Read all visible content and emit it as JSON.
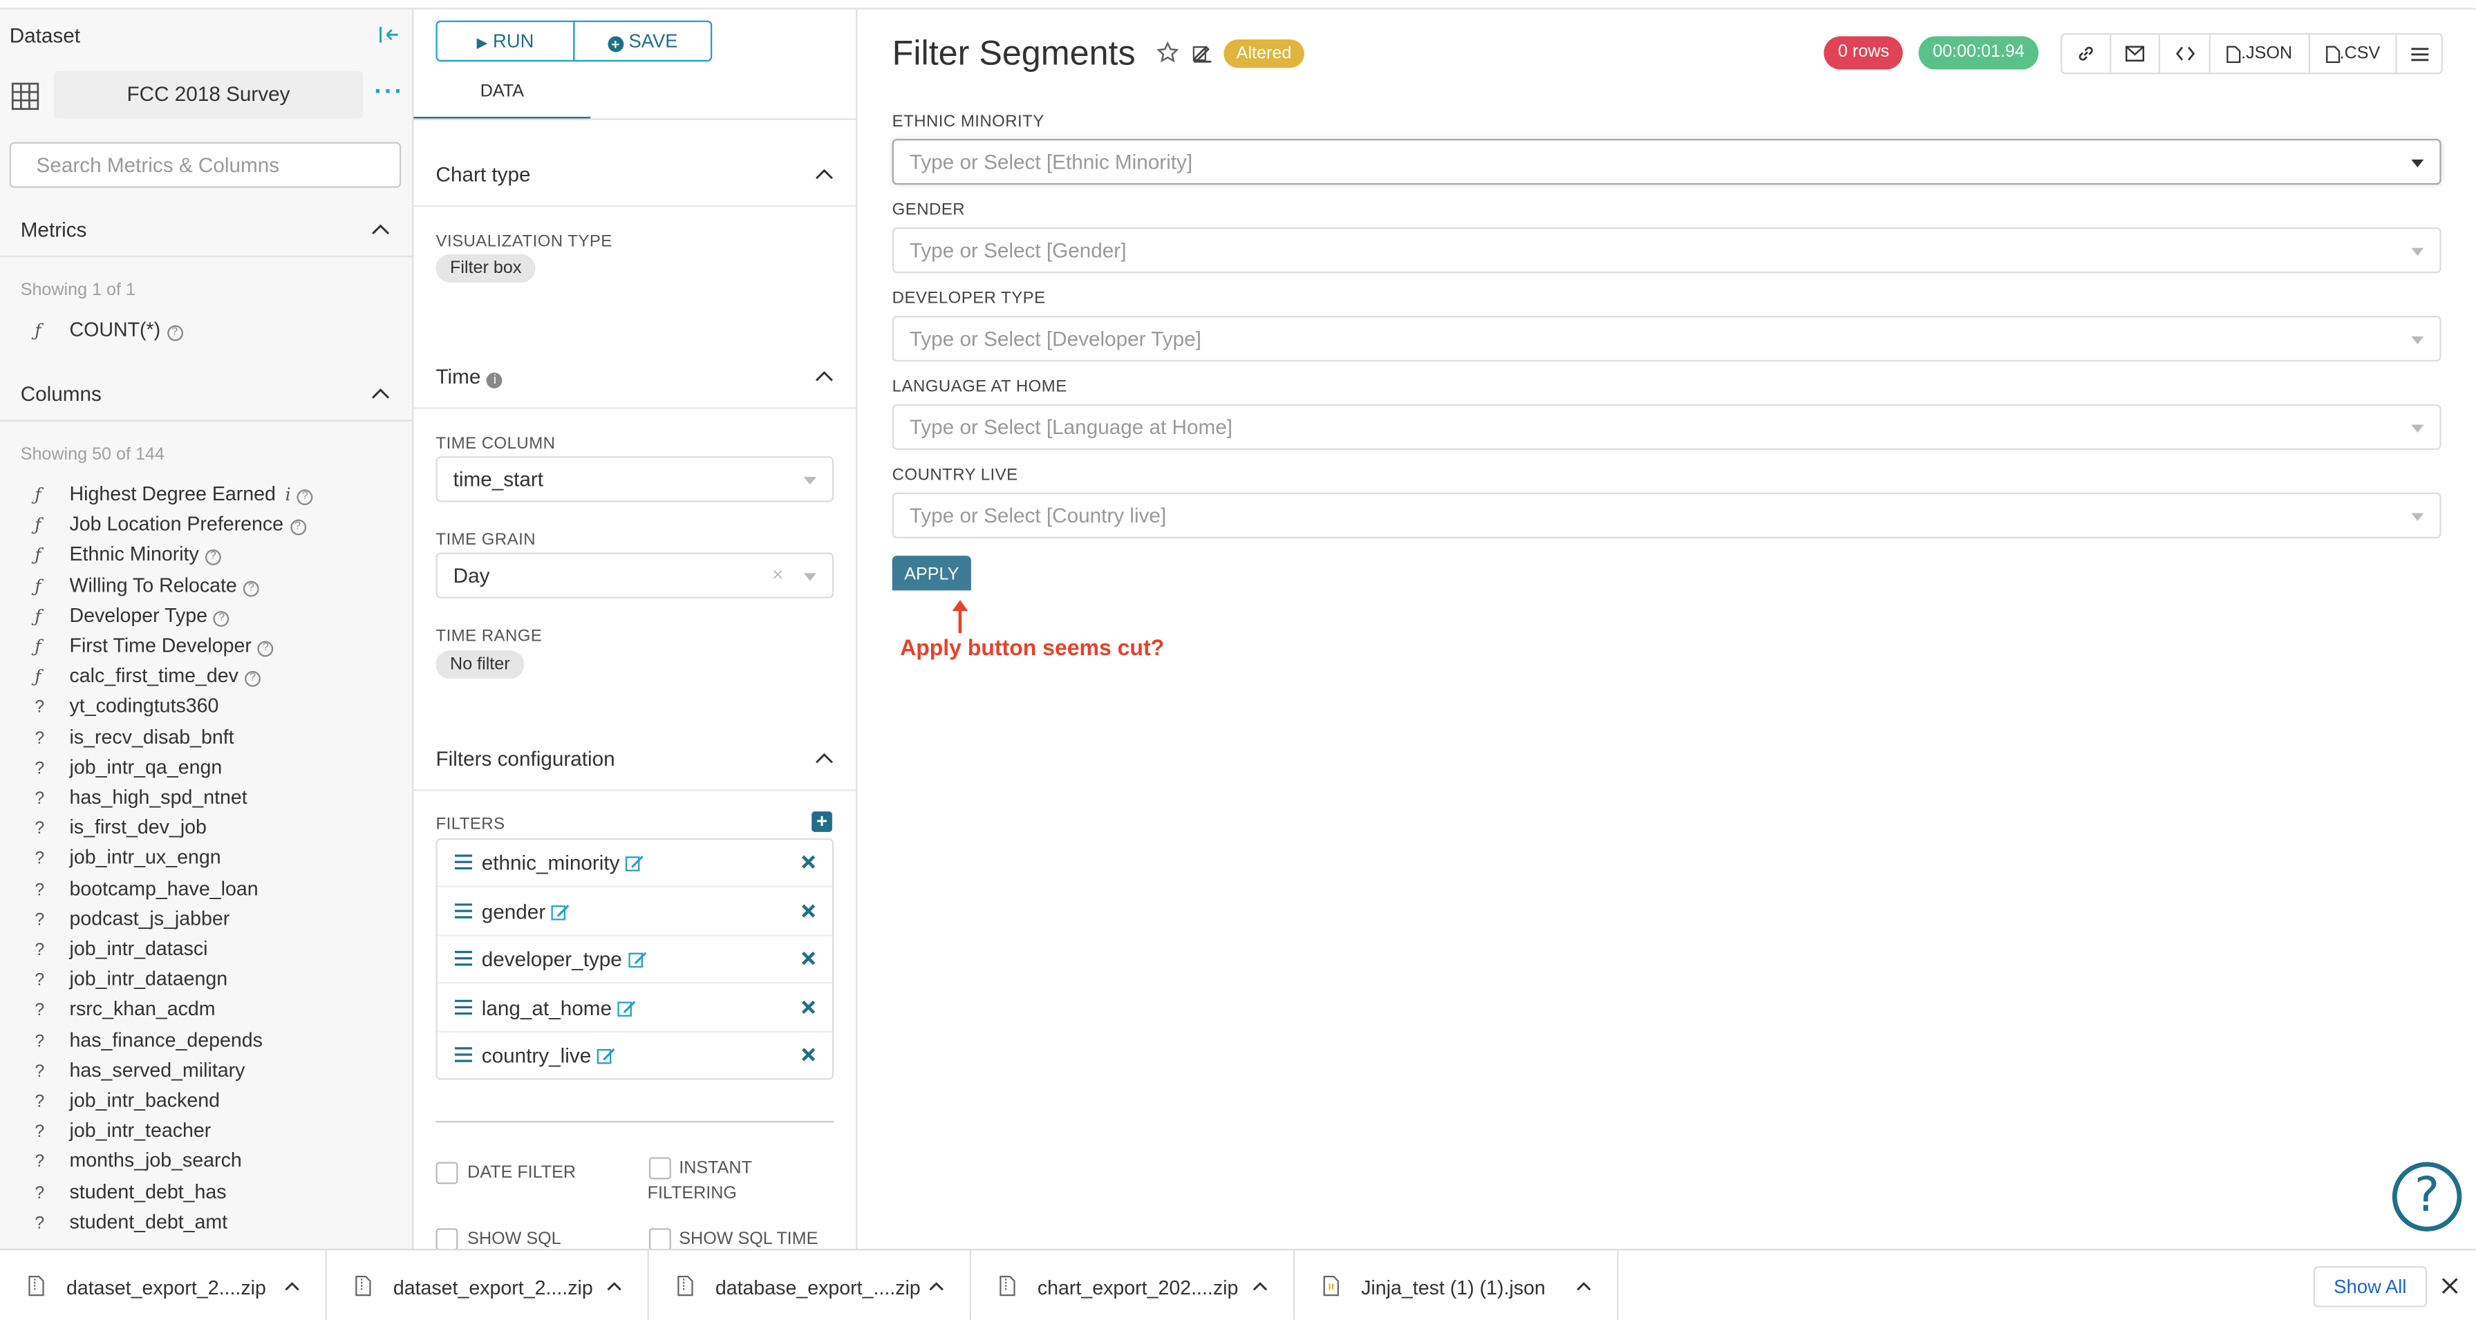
{
  "left": {
    "title": "Dataset",
    "dataset_name": "FCC 2018 Survey",
    "more": "···",
    "search_placeholder": "Search Metrics & Columns",
    "metrics_title": "Metrics",
    "metrics_showing": "Showing 1 of 1",
    "metrics": [
      {
        "type": "ƒ",
        "name": "COUNT(*)"
      }
    ],
    "columns_title": "Columns",
    "columns_showing": "Showing 50 of 144",
    "columns": [
      {
        "type": "ƒ",
        "name": "Highest Degree Earned",
        "info": true
      },
      {
        "type": "ƒ",
        "name": "Job Location Preference"
      },
      {
        "type": "ƒ",
        "name": "Ethnic Minority"
      },
      {
        "type": "ƒ",
        "name": "Willing To Relocate"
      },
      {
        "type": "ƒ",
        "name": "Developer Type"
      },
      {
        "type": "ƒ",
        "name": "First Time Developer"
      },
      {
        "type": "ƒ",
        "name": "calc_first_time_dev"
      },
      {
        "type": "?",
        "name": "yt_codingtuts360"
      },
      {
        "type": "?",
        "name": "is_recv_disab_bnft"
      },
      {
        "type": "?",
        "name": "job_intr_qa_engn"
      },
      {
        "type": "?",
        "name": "has_high_spd_ntnet"
      },
      {
        "type": "?",
        "name": "is_first_dev_job"
      },
      {
        "type": "?",
        "name": "job_intr_ux_engn"
      },
      {
        "type": "?",
        "name": "bootcamp_have_loan"
      },
      {
        "type": "?",
        "name": "podcast_js_jabber"
      },
      {
        "type": "?",
        "name": "job_intr_datasci"
      },
      {
        "type": "?",
        "name": "job_intr_dataengn"
      },
      {
        "type": "?",
        "name": "rsrc_khan_acdm"
      },
      {
        "type": "?",
        "name": "has_finance_depends"
      },
      {
        "type": "?",
        "name": "has_served_military"
      },
      {
        "type": "?",
        "name": "job_intr_backend"
      },
      {
        "type": "?",
        "name": "job_intr_teacher"
      },
      {
        "type": "?",
        "name": "months_job_search"
      },
      {
        "type": "?",
        "name": "student_debt_has"
      },
      {
        "type": "?",
        "name": "student_debt_amt"
      }
    ]
  },
  "mid": {
    "run": "RUN",
    "save": "SAVE",
    "tab": "DATA",
    "chart_type_title": "Chart type",
    "viz_label": "VISUALIZATION TYPE",
    "viz_value": "Filter box",
    "time_title": "Time",
    "time_column_label": "TIME COLUMN",
    "time_column_value": "time_start",
    "time_grain_label": "TIME GRAIN",
    "time_grain_value": "Day",
    "time_range_label": "TIME RANGE",
    "time_range_value": "No filter",
    "filters_conf_title": "Filters configuration",
    "filters_label": "FILTERS",
    "filters": [
      "ethnic_minority",
      "gender",
      "developer_type",
      "lang_at_home",
      "country_live"
    ],
    "date_filter": "DATE FILTER",
    "instant_filtering_1": "INSTANT",
    "instant_filtering_2": "FILTERING",
    "show_sql": "SHOW SQL",
    "show_sql_time": "SHOW SQL TIME"
  },
  "right": {
    "title": "Filter Segments",
    "altered": "Altered",
    "rows": "0 rows",
    "time": "00:00:01.94",
    "json": ".JSON",
    "csv": ".CSV",
    "filters": [
      {
        "label": "ETHNIC MINORITY",
        "placeholder": "Type or Select [Ethnic Minority]"
      },
      {
        "label": "GENDER",
        "placeholder": "Type or Select [Gender]"
      },
      {
        "label": "DEVELOPER TYPE",
        "placeholder": "Type or Select [Developer Type]"
      },
      {
        "label": "LANGUAGE AT HOME",
        "placeholder": "Type or Select [Language at Home]"
      },
      {
        "label": "COUNTRY LIVE",
        "placeholder": "Type or Select [Country live]"
      }
    ],
    "apply": "APPLY",
    "annotation": "Apply button seems cut?",
    "help": "?"
  },
  "downloads": {
    "items": [
      "dataset_export_2....zip",
      "dataset_export_2....zip",
      "database_export_....zip",
      "chart_export_202....zip",
      "Jinja_test (1) (1).json"
    ],
    "show_all": "Show All"
  },
  "colors": {
    "accent": "#1fa3c2",
    "brand": "#1f6f8b",
    "danger": "#e04355",
    "success": "#5ac189",
    "warning": "#e0b43d",
    "annotation": "#e8402a"
  }
}
